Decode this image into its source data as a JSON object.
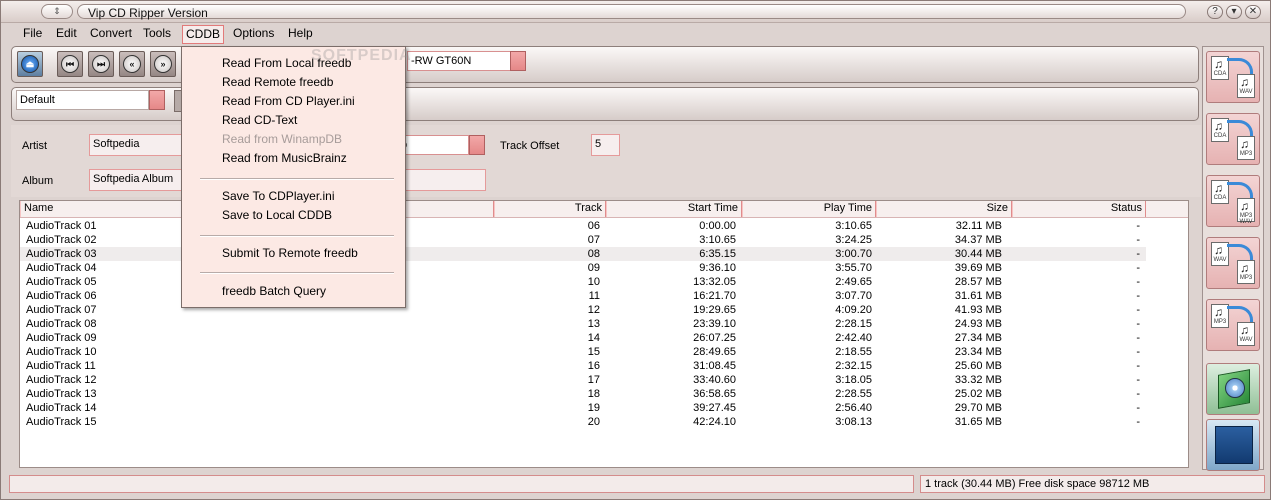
{
  "window": {
    "title": "Vip CD Ripper Version",
    "system_menu_glyph": "⇕"
  },
  "menubar": [
    "File",
    "Edit",
    "Convert",
    "Tools",
    "CDDB",
    "Options",
    "Help"
  ],
  "toolbar": {
    "drive": "-RW GT60N",
    "profile": "Default"
  },
  "info": {
    "artist_label": "Artist",
    "artist": "Softpedia",
    "album_label": "Album",
    "album": "Softpedia Album",
    "genre_partial": "o",
    "track_offset_label": "Track Offset",
    "track_offset": "5"
  },
  "columns": [
    "Name",
    "Track",
    "Start Time",
    "Play Time",
    "Size",
    "Status"
  ],
  "tracks": [
    {
      "name": "AudioTrack 01",
      "track": "06",
      "start": "0:00.00",
      "play": "3:10.65",
      "size": "32.11 MB",
      "status": "-"
    },
    {
      "name": "AudioTrack 02",
      "track": "07",
      "start": "3:10.65",
      "play": "3:24.25",
      "size": "34.37 MB",
      "status": "-"
    },
    {
      "name": "AudioTrack 03",
      "track": "08",
      "start": "6:35.15",
      "play": "3:00.70",
      "size": "30.44 MB",
      "status": "-"
    },
    {
      "name": "AudioTrack 04",
      "track": "09",
      "start": "9:36.10",
      "play": "3:55.70",
      "size": "39.69 MB",
      "status": "-"
    },
    {
      "name": "AudioTrack 05",
      "track": "10",
      "start": "13:32.05",
      "play": "2:49.65",
      "size": "28.57 MB",
      "status": "-"
    },
    {
      "name": "AudioTrack 06",
      "track": "11",
      "start": "16:21.70",
      "play": "3:07.70",
      "size": "31.61 MB",
      "status": "-"
    },
    {
      "name": "AudioTrack 07",
      "track": "12",
      "start": "19:29.65",
      "play": "4:09.20",
      "size": "41.93 MB",
      "status": "-"
    },
    {
      "name": "AudioTrack 08",
      "track": "13",
      "start": "23:39.10",
      "play": "2:28.15",
      "size": "24.93 MB",
      "status": "-"
    },
    {
      "name": "AudioTrack 09",
      "track": "14",
      "start": "26:07.25",
      "play": "2:42.40",
      "size": "27.34 MB",
      "status": "-"
    },
    {
      "name": "AudioTrack 10",
      "track": "15",
      "start": "28:49.65",
      "play": "2:18.55",
      "size": "23.34 MB",
      "status": "-"
    },
    {
      "name": "AudioTrack 11",
      "track": "16",
      "start": "31:08.45",
      "play": "2:32.15",
      "size": "25.60 MB",
      "status": "-"
    },
    {
      "name": "AudioTrack 12",
      "track": "17",
      "start": "33:40.60",
      "play": "3:18.05",
      "size": "33.32 MB",
      "status": "-"
    },
    {
      "name": "AudioTrack 13",
      "track": "18",
      "start": "36:58.65",
      "play": "2:28.55",
      "size": "25.02 MB",
      "status": "-"
    },
    {
      "name": "AudioTrack 14",
      "track": "19",
      "start": "39:27.45",
      "play": "2:56.40",
      "size": "29.70 MB",
      "status": "-"
    },
    {
      "name": "AudioTrack 15",
      "track": "20",
      "start": "42:24.10",
      "play": "3:08.13",
      "size": "31.65 MB",
      "status": "-"
    }
  ],
  "selected_track_index": 2,
  "cddb_menu": [
    {
      "label": "Read From Local freedb",
      "enabled": true
    },
    {
      "label": "Read Remote freedb",
      "enabled": true
    },
    {
      "label": "Read From CD Player.ini",
      "enabled": true
    },
    {
      "label": "Read CD-Text",
      "enabled": true
    },
    {
      "label": "Read from WinampDB",
      "enabled": false
    },
    {
      "label": "Read from MusicBrainz",
      "enabled": true
    },
    {
      "label": "Save To CDPlayer.ini",
      "enabled": true
    },
    {
      "label": "Save to Local CDDB",
      "enabled": true
    },
    {
      "label": "Submit To Remote freedb",
      "enabled": true
    },
    {
      "label": "freedb Batch Query",
      "enabled": true
    }
  ],
  "sidebar": [
    {
      "from": "CDA",
      "to": "WAV"
    },
    {
      "from": "CDA",
      "to": "MP3"
    },
    {
      "from": "CDA",
      "to": "MP3 WAV"
    },
    {
      "from": "WAV",
      "to": "MP3"
    },
    {
      "from": "MP3",
      "to": "WAV"
    }
  ],
  "status_text": "1 track (30.44 MB) Free disk space 98712 MB",
  "watermark": "SOFTPEDIA",
  "colors": {
    "accent_pink": "#e58888",
    "selected_row": "#efecec"
  }
}
